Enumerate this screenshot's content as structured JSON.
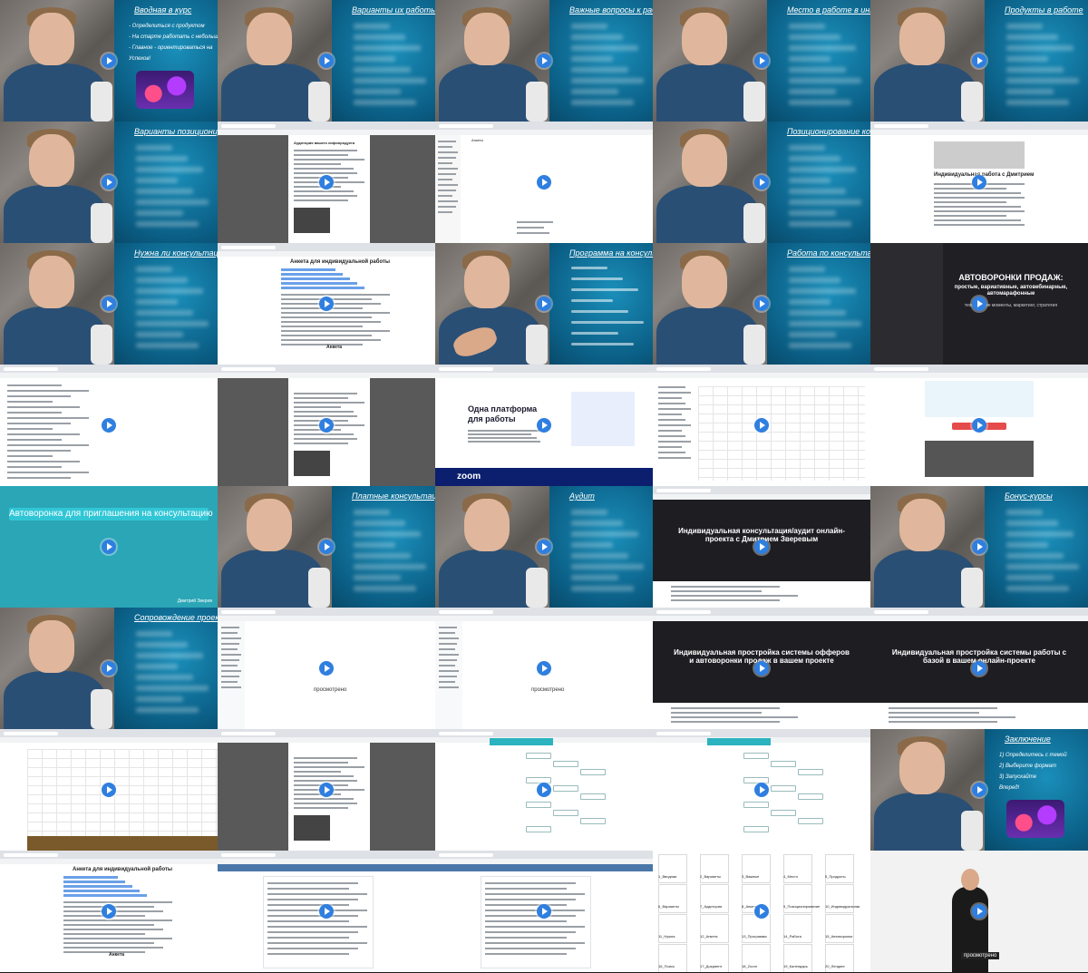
{
  "grid": {
    "columns": 5,
    "rows": 8
  },
  "tiles": [
    {
      "kind": "presenter",
      "board_title": "Вводная в курс",
      "bullets": [
        "- Определиться с продуктом",
        "- На старте работать с небольшими",
        "- Главное - ориентироваться на",
        "Успехов!"
      ]
    },
    {
      "kind": "presenter",
      "board_title": "Варианты их работы",
      "blurred": true
    },
    {
      "kind": "presenter",
      "board_title": "Важные вопросы к работе",
      "blurred": true
    },
    {
      "kind": "presenter",
      "board_title": "Место в работе в интернете",
      "blurred": true
    },
    {
      "kind": "presenter",
      "board_title": "Продукты в работе",
      "blurred": true
    },
    {
      "kind": "presenter",
      "board_title": "Варианты позиционирования",
      "blurred": true
    },
    {
      "kind": "doc-pdf",
      "heading": "Аудитория вашего инфопродукта"
    },
    {
      "kind": "web-form",
      "title": "Анкета"
    },
    {
      "kind": "presenter",
      "board_title": "Позиционирование консультации",
      "blurred": true
    },
    {
      "kind": "web-page",
      "heading": "Индивидуальная работа с Дмитрием"
    },
    {
      "kind": "presenter",
      "board_title": "Нужна ли консультация?",
      "blurred": true
    },
    {
      "kind": "doc",
      "heading": "Анкета для индивидуальной работы",
      "sub": "Анкета"
    },
    {
      "kind": "presenter-hand",
      "board_title": "Программа на консультацию"
    },
    {
      "kind": "presenter",
      "board_title": "Работа по консультации",
      "blurred": true
    },
    {
      "kind": "landing-dark",
      "heading": "АВТОВОРОНКИ ПРОДАЖ:",
      "heading2": "простые, вариативные, автовебинарные, автомарафонные",
      "heading3": "технические моменты, маркетинг, стратегия"
    },
    {
      "kind": "search",
      "heading": ""
    },
    {
      "kind": "doc-pdf2",
      "heading": ""
    },
    {
      "kind": "zoom",
      "hero": "Одна платформа для работы",
      "logo": "zoom"
    },
    {
      "kind": "calendar",
      "heading": ""
    },
    {
      "kind": "landing-red",
      "heading": ""
    },
    {
      "kind": "banner",
      "title": "Автоворонка для приглашения на консультацию",
      "author": "Дмитрий Зверев"
    },
    {
      "kind": "presenter",
      "board_title": "Платные консультации",
      "blurred": true
    },
    {
      "kind": "presenter",
      "board_title": "Аудит",
      "blurred": true
    },
    {
      "kind": "landing-dark2",
      "heading": "Индивидуальная консультация/аудит онлайн-проекта с Дмитрием Зверевым"
    },
    {
      "kind": "presenter",
      "board_title": "Бонус-курсы",
      "blurred": true
    },
    {
      "kind": "presenter",
      "board_title": "Сопровождение проекта",
      "blurred": true
    },
    {
      "kind": "drive",
      "status": "просмотрено"
    },
    {
      "kind": "folder",
      "status": "просмотрено"
    },
    {
      "kind": "landing-dark3",
      "heading": "Индивидуальная простройка системы офферов и автоворонки продаж в вашем проекте"
    },
    {
      "kind": "landing-dark4",
      "heading": "Индивидуальная простройка системы работы с базой в вашем онлайн-проекте"
    },
    {
      "kind": "sheet",
      "heading": ""
    },
    {
      "kind": "doc-pdf3",
      "heading": ""
    },
    {
      "kind": "mindmap",
      "heading": ""
    },
    {
      "kind": "mindmap2",
      "heading": ""
    },
    {
      "kind": "presenter",
      "board_title": "Заключение",
      "bullets": [
        "1) Определитесь с темой",
        "2) Выберите формат",
        "3) Запускайте",
        "Вперед!"
      ]
    },
    {
      "kind": "doc2",
      "heading": "Анкета для индивидуальной работы",
      "sub": "Анкета"
    },
    {
      "kind": "vk",
      "heading": ""
    },
    {
      "kind": "vk2",
      "heading": ""
    },
    {
      "kind": "thumbs",
      "captions": [
        "1_Вводная",
        "2_Варианты",
        "3_Важные",
        "4_Место",
        "5_Продукты",
        "6_Варианты",
        "7_Аудитория",
        "8_Анкета",
        "9_Позиционирование",
        "10_Индивидуальная",
        "11_Нужна",
        "12_Анкета",
        "13_Программа",
        "14_Работа",
        "15_Автоворонки",
        "16_Поиск",
        "17_Документ",
        "18_Zoom",
        "19_Календарь",
        "20_Лендинг"
      ]
    },
    {
      "kind": "stage",
      "status": "просмотрено"
    }
  ]
}
